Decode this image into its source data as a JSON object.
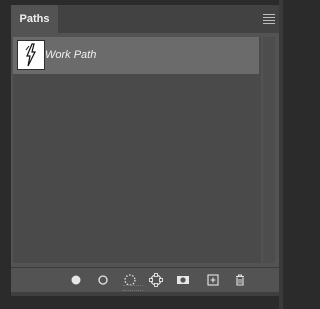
{
  "panel": {
    "tab_label": "Paths",
    "menu_icon": "panel-menu-icon"
  },
  "paths": [
    {
      "label": "Work Path",
      "selected": true,
      "thumbnail_icon": "path-thumbnail-icon"
    }
  ],
  "footer": {
    "buttons": [
      {
        "name": "fill-path-button",
        "icon": "filled-circle-icon"
      },
      {
        "name": "stroke-path-button",
        "icon": "hollow-circle-icon"
      },
      {
        "name": "load-selection-button",
        "icon": "dotted-circle-icon"
      },
      {
        "name": "make-work-path-button",
        "icon": "path-anchor-icon"
      },
      {
        "name": "add-mask-button",
        "icon": "mask-icon"
      },
      {
        "name": "new-path-button",
        "icon": "new-path-icon"
      },
      {
        "name": "delete-path-button",
        "icon": "trash-icon"
      }
    ]
  },
  "colors": {
    "panel_bg": "#535353",
    "selected_row": "#6b6b6b",
    "text": "#f2f2f2"
  }
}
